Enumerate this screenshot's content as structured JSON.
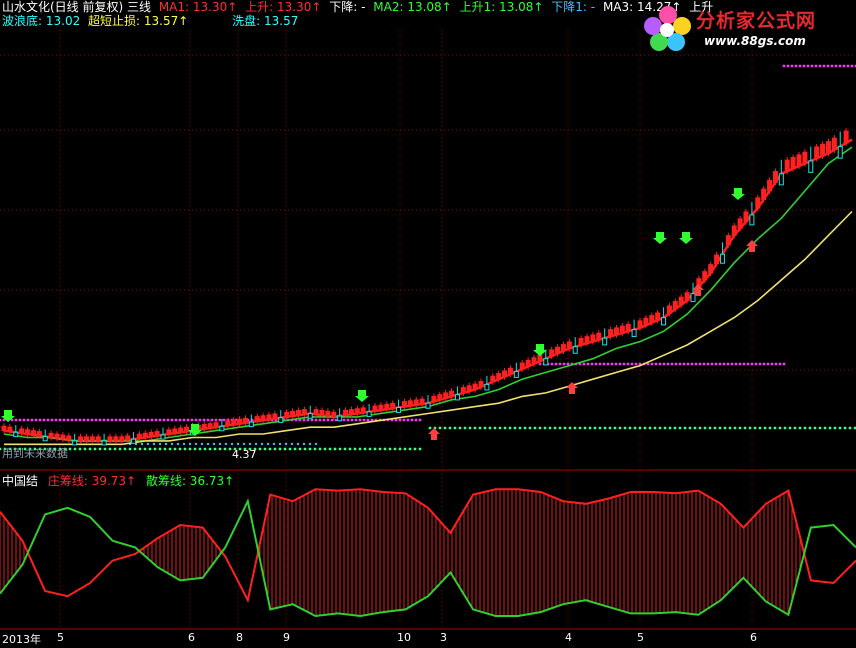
{
  "header": {
    "title": "山水文化(日线 前复权) 三线",
    "ma1": "MA1: 13.30↑",
    "up1": "上升: 13.30↑",
    "down1": "下降: -",
    "ma2": "MA2: 13.08↑",
    "up2": "上升1: 13.08↑",
    "down2": "下降1: -",
    "ma3": "MA3: 14.27↑",
    "up3": "上升",
    "wave_bottom": "波浪底: 13.02",
    "super_stop": "超短止损: 13.57↑",
    "washout": "洗盘: 13.57"
  },
  "watermark": {
    "text": "分析家公式网",
    "url": "www.88gs.com"
  },
  "main_labels": {
    "left_note": "用到未来数据",
    "price_label": "4.37"
  },
  "indicator": {
    "name": "中国结",
    "line1": "庄筹线: 39.73↑",
    "line2": "散筹线: 36.73↑"
  },
  "dates": [
    "2013年",
    "5",
    "6",
    "8",
    "9",
    "10",
    "3",
    "4",
    "5",
    "6"
  ],
  "colors": {
    "bg": "#000000",
    "up": "#ff2020",
    "down": "#20e0e0",
    "ma_green": "#30d030",
    "ma_yellow": "#f0e070",
    "magenta": "#ff30ff",
    "green_dot": "#40ff80",
    "grid": "#8b0000",
    "white": "#ffffff",
    "cyan": "#40c0ff"
  },
  "chart_data": {
    "type": "line",
    "price_series": [
      {
        "name": "MA1",
        "values": [
          4.8,
          4.7,
          4.6,
          4.5,
          4.5,
          4.5,
          4.6,
          4.7,
          4.8,
          4.9,
          5.0,
          5.1,
          5.2,
          5.3,
          5.2,
          5.3,
          5.4,
          5.5,
          5.6,
          5.8,
          6.0,
          6.3,
          6.6,
          6.9,
          7.2,
          7.4,
          7.6,
          7.8,
          8.1,
          8.6,
          9.4,
          10.5,
          11.3,
          12.3,
          12.6,
          12.9,
          13.3
        ]
      },
      {
        "name": "MA2",
        "values": [
          4.7,
          4.6,
          4.6,
          4.5,
          4.5,
          4.5,
          4.5,
          4.6,
          4.7,
          4.8,
          4.9,
          5.0,
          5.1,
          5.2,
          5.2,
          5.2,
          5.3,
          5.4,
          5.5,
          5.7,
          5.8,
          6.0,
          6.3,
          6.5,
          6.7,
          6.9,
          7.2,
          7.4,
          7.7,
          8.2,
          8.9,
          9.7,
          10.4,
          11.0,
          11.8,
          12.6,
          13.08
        ]
      },
      {
        "name": "MA3",
        "values": [
          4.4,
          4.4,
          4.4,
          4.4,
          4.4,
          4.4,
          4.5,
          4.5,
          4.6,
          4.6,
          4.7,
          4.7,
          4.8,
          4.9,
          4.9,
          5.0,
          5.1,
          5.2,
          5.3,
          5.4,
          5.5,
          5.6,
          5.8,
          5.9,
          6.1,
          6.3,
          6.5,
          6.7,
          7.0,
          7.3,
          7.7,
          8.1,
          8.6,
          9.2,
          9.8,
          10.5,
          11.2
        ]
      }
    ],
    "indicator_series": [
      {
        "name": "庄筹线",
        "values": [
          82,
          60,
          22,
          18,
          28,
          45,
          50,
          62,
          72,
          70,
          48,
          15,
          95,
          90,
          99,
          98,
          99,
          97,
          96,
          85,
          66,
          95,
          99,
          99,
          97,
          90,
          88,
          92,
          97,
          97,
          96,
          98,
          88,
          70,
          88,
          98,
          30,
          28,
          45
        ]
      },
      {
        "name": "散筹线",
        "values": [
          20,
          42,
          80,
          85,
          78,
          60,
          55,
          40,
          30,
          32,
          55,
          90,
          8,
          12,
          3,
          5,
          3,
          6,
          8,
          18,
          36,
          8,
          3,
          3,
          6,
          12,
          15,
          10,
          5,
          5,
          6,
          4,
          15,
          32,
          14,
          4,
          70,
          72,
          55
        ]
      }
    ],
    "last_values": {
      "MA1": 13.3,
      "MA2": 13.08,
      "MA3": 14.27,
      "庄筹线": 39.73,
      "散筹线": 36.73
    }
  }
}
